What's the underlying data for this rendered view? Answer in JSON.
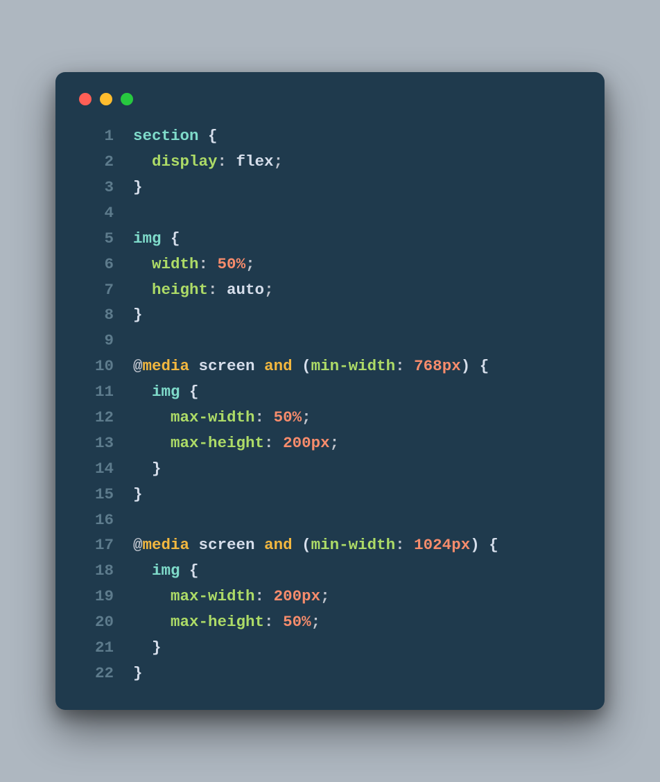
{
  "code": {
    "lines": [
      {
        "n": "1",
        "tokens": [
          {
            "t": "section ",
            "c": "c-sel"
          },
          {
            "t": "{",
            "c": "c-brace"
          }
        ]
      },
      {
        "n": "2",
        "tokens": [
          {
            "t": "  ",
            "c": ""
          },
          {
            "t": "display",
            "c": "c-prop"
          },
          {
            "t": ": ",
            "c": "c-punc"
          },
          {
            "t": "flex",
            "c": "c-val"
          },
          {
            "t": ";",
            "c": "c-punc"
          }
        ]
      },
      {
        "n": "3",
        "tokens": [
          {
            "t": "}",
            "c": "c-brace"
          }
        ]
      },
      {
        "n": "4",
        "tokens": [
          {
            "t": "",
            "c": ""
          }
        ]
      },
      {
        "n": "5",
        "tokens": [
          {
            "t": "img ",
            "c": "c-sel"
          },
          {
            "t": "{",
            "c": "c-brace"
          }
        ]
      },
      {
        "n": "6",
        "tokens": [
          {
            "t": "  ",
            "c": ""
          },
          {
            "t": "width",
            "c": "c-prop"
          },
          {
            "t": ": ",
            "c": "c-punc"
          },
          {
            "t": "50",
            "c": "c-num"
          },
          {
            "t": "%",
            "c": "c-unit"
          },
          {
            "t": ";",
            "c": "c-punc"
          }
        ]
      },
      {
        "n": "7",
        "tokens": [
          {
            "t": "  ",
            "c": ""
          },
          {
            "t": "height",
            "c": "c-prop"
          },
          {
            "t": ": ",
            "c": "c-punc"
          },
          {
            "t": "auto",
            "c": "c-val"
          },
          {
            "t": ";",
            "c": "c-punc"
          }
        ]
      },
      {
        "n": "8",
        "tokens": [
          {
            "t": "}",
            "c": "c-brace"
          }
        ]
      },
      {
        "n": "9",
        "tokens": [
          {
            "t": "",
            "c": ""
          }
        ]
      },
      {
        "n": "10",
        "tokens": [
          {
            "t": "@",
            "c": "c-punc"
          },
          {
            "t": "media",
            "c": "c-kw"
          },
          {
            "t": " ",
            "c": ""
          },
          {
            "t": "screen",
            "c": "c-val"
          },
          {
            "t": " ",
            "c": ""
          },
          {
            "t": "and",
            "c": "c-kw"
          },
          {
            "t": " ",
            "c": ""
          },
          {
            "t": "(",
            "c": "c-paren"
          },
          {
            "t": "min-width",
            "c": "c-prop"
          },
          {
            "t": ": ",
            "c": "c-punc"
          },
          {
            "t": "768",
            "c": "c-num"
          },
          {
            "t": "px",
            "c": "c-unit"
          },
          {
            "t": ")",
            "c": "c-paren"
          },
          {
            "t": " {",
            "c": "c-brace"
          }
        ]
      },
      {
        "n": "11",
        "tokens": [
          {
            "t": "  ",
            "c": ""
          },
          {
            "t": "img ",
            "c": "c-sel"
          },
          {
            "t": "{",
            "c": "c-brace"
          }
        ]
      },
      {
        "n": "12",
        "tokens": [
          {
            "t": "    ",
            "c": ""
          },
          {
            "t": "max-width",
            "c": "c-prop"
          },
          {
            "t": ": ",
            "c": "c-punc"
          },
          {
            "t": "50",
            "c": "c-num"
          },
          {
            "t": "%",
            "c": "c-unit"
          },
          {
            "t": ";",
            "c": "c-punc"
          }
        ]
      },
      {
        "n": "13",
        "tokens": [
          {
            "t": "    ",
            "c": ""
          },
          {
            "t": "max-height",
            "c": "c-prop"
          },
          {
            "t": ": ",
            "c": "c-punc"
          },
          {
            "t": "200",
            "c": "c-num"
          },
          {
            "t": "px",
            "c": "c-unit"
          },
          {
            "t": ";",
            "c": "c-punc"
          }
        ]
      },
      {
        "n": "14",
        "tokens": [
          {
            "t": "  ",
            "c": ""
          },
          {
            "t": "}",
            "c": "c-brace"
          }
        ]
      },
      {
        "n": "15",
        "tokens": [
          {
            "t": "}",
            "c": "c-brace"
          }
        ]
      },
      {
        "n": "16",
        "tokens": [
          {
            "t": "",
            "c": ""
          }
        ]
      },
      {
        "n": "17",
        "tokens": [
          {
            "t": "@",
            "c": "c-punc"
          },
          {
            "t": "media",
            "c": "c-kw"
          },
          {
            "t": " ",
            "c": ""
          },
          {
            "t": "screen",
            "c": "c-val"
          },
          {
            "t": " ",
            "c": ""
          },
          {
            "t": "and",
            "c": "c-kw"
          },
          {
            "t": " ",
            "c": ""
          },
          {
            "t": "(",
            "c": "c-paren"
          },
          {
            "t": "min-width",
            "c": "c-prop"
          },
          {
            "t": ": ",
            "c": "c-punc"
          },
          {
            "t": "1024",
            "c": "c-num"
          },
          {
            "t": "px",
            "c": "c-unit"
          },
          {
            "t": ")",
            "c": "c-paren"
          },
          {
            "t": " {",
            "c": "c-brace"
          }
        ]
      },
      {
        "n": "18",
        "tokens": [
          {
            "t": "  ",
            "c": ""
          },
          {
            "t": "img ",
            "c": "c-sel"
          },
          {
            "t": "{",
            "c": "c-brace"
          }
        ]
      },
      {
        "n": "19",
        "tokens": [
          {
            "t": "    ",
            "c": ""
          },
          {
            "t": "max-width",
            "c": "c-prop"
          },
          {
            "t": ": ",
            "c": "c-punc"
          },
          {
            "t": "200",
            "c": "c-num"
          },
          {
            "t": "px",
            "c": "c-unit"
          },
          {
            "t": ";",
            "c": "c-punc"
          }
        ]
      },
      {
        "n": "20",
        "tokens": [
          {
            "t": "    ",
            "c": ""
          },
          {
            "t": "max-height",
            "c": "c-prop"
          },
          {
            "t": ": ",
            "c": "c-punc"
          },
          {
            "t": "50",
            "c": "c-num"
          },
          {
            "t": "%",
            "c": "c-unit"
          },
          {
            "t": ";",
            "c": "c-punc"
          }
        ]
      },
      {
        "n": "21",
        "tokens": [
          {
            "t": "  ",
            "c": ""
          },
          {
            "t": "}",
            "c": "c-brace"
          }
        ]
      },
      {
        "n": "22",
        "tokens": [
          {
            "t": "}",
            "c": "c-brace"
          }
        ]
      }
    ]
  }
}
